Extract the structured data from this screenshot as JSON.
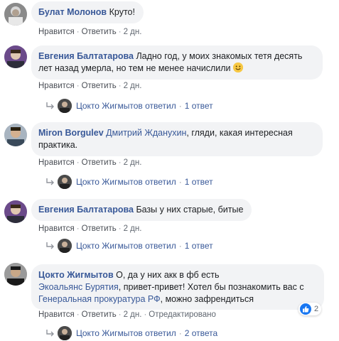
{
  "common": {
    "like": "Нравится",
    "reply": "Ответить",
    "edited": "Отредактировано",
    "reply_author": "Цокто Жигмытов ответил",
    "dot": "·"
  },
  "comments": [
    {
      "author": "Булат Молонов",
      "text": "Круто!",
      "time": "2 дн."
    },
    {
      "author": "Евгения Балтатарова",
      "text_line1": "Ладно год, у моих знакомых тетя десять",
      "text_line2": "лет назад умерла, но тем не менее начислили",
      "emoji": "smile-emoji",
      "time": "2 дн.",
      "replies": "1 ответ"
    },
    {
      "author": "Miron Borgulev",
      "mention": "Дмитрий Жданухин",
      "text_line1": ", гляди, какая интересная",
      "text_line2": "практика.",
      "time": "2 дн.",
      "replies": "1 ответ"
    },
    {
      "author": "Евгения Балтатарова",
      "text": "Базы у них старые, битые",
      "time": "2 дн.",
      "replies": "1 ответ"
    },
    {
      "author": "Цокто Жигмытов",
      "text_line1": "О, да у них акк в фб есть",
      "mention1": "Экоальянс Бурятия",
      "text_line2": ", привет-привет! Хотел бы познакомить вас с",
      "mention2": "Генеральная прокуратура РФ",
      "text_line3": ", можно зафрендиться",
      "time": "2 дн.",
      "reaction_count": "2",
      "replies": "2 ответа"
    }
  ],
  "colors": {
    "link": "#385898",
    "bubble": "#f2f3f5",
    "like_blue": "#1877f2"
  }
}
